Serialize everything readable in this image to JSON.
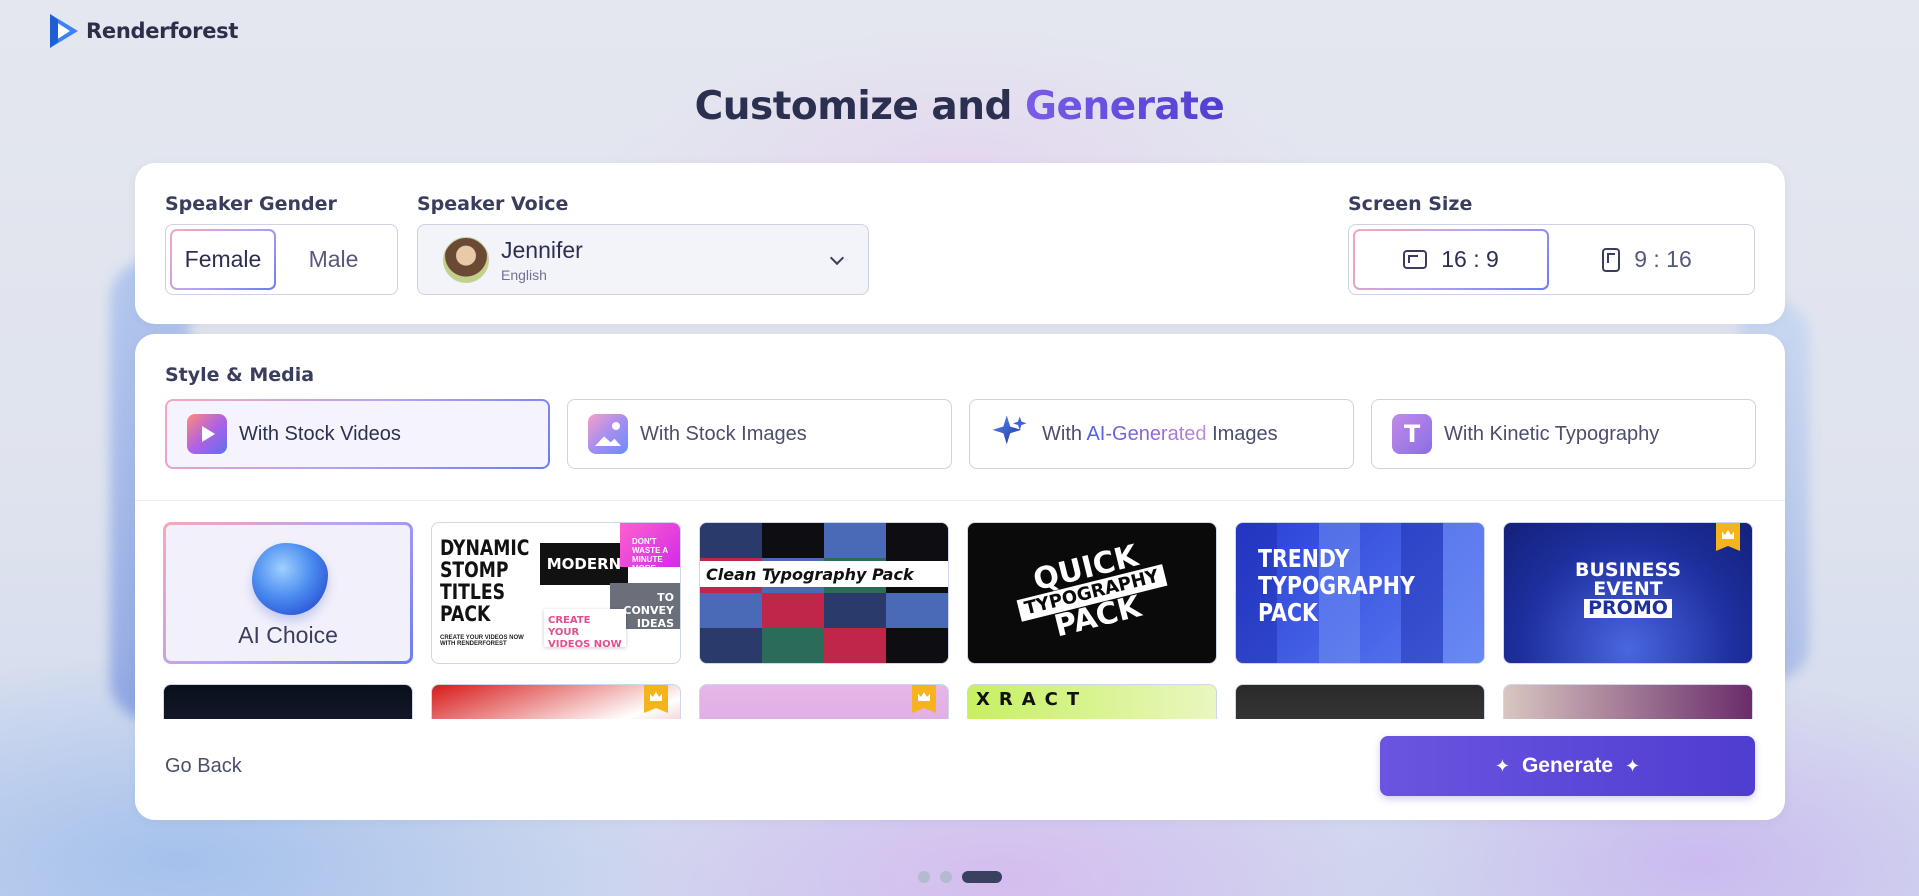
{
  "brand": {
    "name": "Renderforest"
  },
  "title": {
    "prefix": "Customize and ",
    "accent": "Generate"
  },
  "speaker_gender": {
    "label": "Speaker Gender",
    "options": [
      "Female",
      "Male"
    ],
    "selected": "Female"
  },
  "speaker_voice": {
    "label": "Speaker Voice",
    "name": "Jennifer",
    "language": "English"
  },
  "screen_size": {
    "label": "Screen Size",
    "options": [
      "16 : 9",
      "9 : 16"
    ],
    "selected": "16 : 9"
  },
  "style_media": {
    "label": "Style & Media",
    "tabs": [
      {
        "label": "With Stock Videos",
        "icon": "stock-video-icon",
        "active": true
      },
      {
        "label": "With Stock Images",
        "icon": "stock-image-icon",
        "active": false
      },
      {
        "label_prefix": "With ",
        "label_accent": "AI-Generated",
        "label_suffix": " Images",
        "icon": "ai-sparkle-icon",
        "active": false
      },
      {
        "label": "With Kinetic Typography",
        "icon": "typography-icon",
        "icon_letter": "T",
        "active": false
      }
    ]
  },
  "templates": {
    "ai_choice": {
      "label": "AI Choice",
      "selected": true
    },
    "stomp": {
      "title": "DYNAMIC STOMP TITLES PACK",
      "modern": "MODERN",
      "dont_waste": "DON'T WASTE A MINUTE MORE",
      "convey": "TO CONVEY IDEAS",
      "create": "CREATE YOUR VIDEOS NOW",
      "small": "CREATE YOUR VIDEOS NOW WITH RENDERFOREST"
    },
    "clean": {
      "title": "Clean Typography Pack"
    },
    "quick": {
      "line1": "QUICK",
      "line2": "TYPOGRAPHY",
      "line3": "PACK"
    },
    "trendy": {
      "title": "TRENDY TYPOGRAPHY PACK"
    },
    "business": {
      "line1": "BUSINESS",
      "line2": "EVENT",
      "line3": "PROMO",
      "premium": true
    },
    "row2_text": "XRACT",
    "row2_premium": [
      false,
      true,
      true,
      false,
      false,
      false
    ]
  },
  "footer": {
    "back_label": "Go Back",
    "generate_label": "Generate"
  },
  "pager": {
    "count": 3,
    "active": 3
  },
  "colors": {
    "accent": "#5a45d8",
    "premium": "#f5b31c",
    "text": "#2c3050"
  }
}
